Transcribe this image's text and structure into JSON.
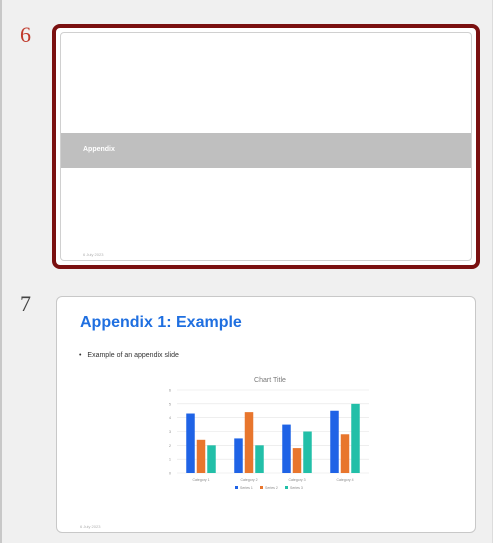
{
  "slides": [
    {
      "number": "6",
      "selected": true,
      "title": "Appendix",
      "date": "6 July 2023"
    },
    {
      "number": "7",
      "selected": false,
      "title": "Appendix 1: Example",
      "bullet": "Example of an appendix slide",
      "date": "6 July 2023",
      "bullet_glyph": "•"
    }
  ],
  "colors": {
    "selection_border": "#7a1010",
    "selected_number": "#c0392b",
    "title_blue": "#1f6fe0",
    "band_gray": "#bfbfbf",
    "series": [
      "#1f63e6",
      "#e8762d",
      "#22bfa8"
    ]
  },
  "chart_data": {
    "type": "bar",
    "title": "Chart Title",
    "categories": [
      "Category 1",
      "Category 2",
      "Category 3",
      "Category 4"
    ],
    "series": [
      {
        "name": "Series 1",
        "values": [
          4.3,
          2.5,
          3.5,
          4.5
        ]
      },
      {
        "name": "Series 2",
        "values": [
          2.4,
          4.4,
          1.8,
          2.8
        ]
      },
      {
        "name": "Series 3",
        "values": [
          2.0,
          2.0,
          3.0,
          5.0
        ]
      }
    ],
    "yticks": [
      "0",
      "1",
      "2",
      "3",
      "4",
      "5",
      "6"
    ],
    "ylim": [
      0,
      6
    ],
    "grid": true,
    "legend": "bottom"
  }
}
